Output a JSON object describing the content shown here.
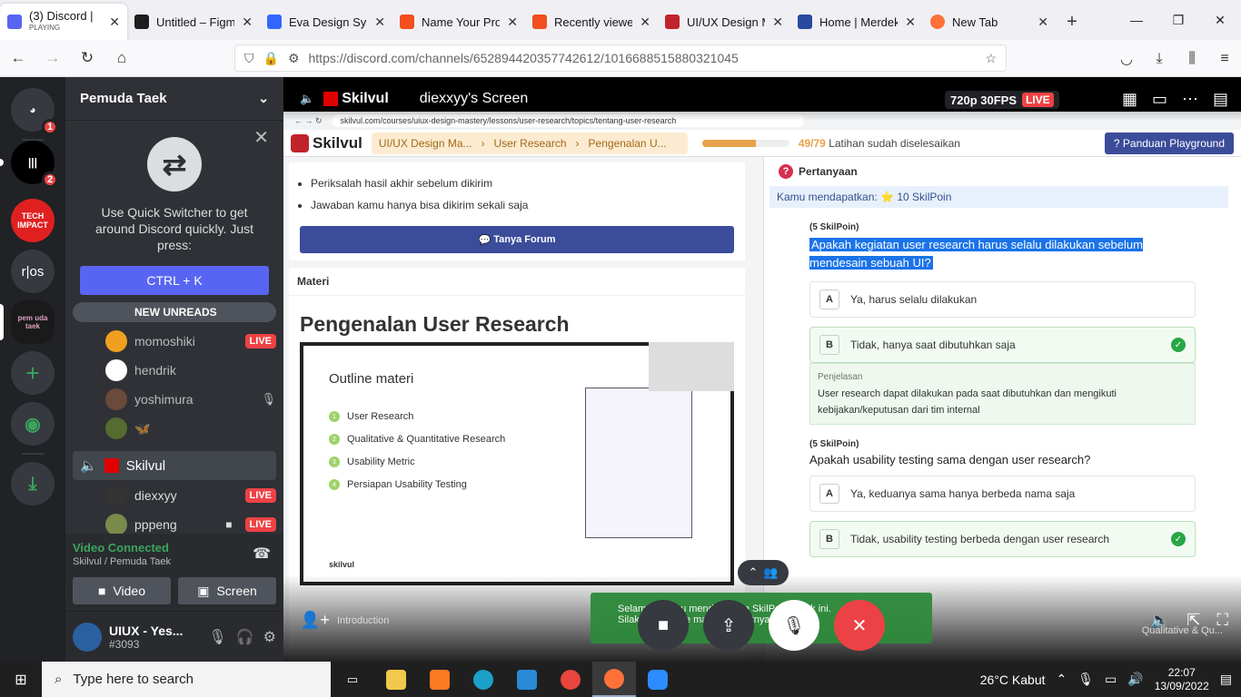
{
  "browser": {
    "tabs": [
      {
        "title": "(3) Discord | ",
        "sub": "PLAYING",
        "color": "#5865f2",
        "active": true
      },
      {
        "title": "Untitled – Figma",
        "color": "#1e1e1e"
      },
      {
        "title": "Eva Design Syste",
        "color": "#3366ff"
      },
      {
        "title": "Name Your Proje",
        "color": "#f24e1e"
      },
      {
        "title": "Recently viewed",
        "color": "#f24e1e"
      },
      {
        "title": "UI/UX Design Ma",
        "color": "#c0232c"
      },
      {
        "title": "Home | Merdeka",
        "color": "#2a4aa0"
      },
      {
        "title": "New Tab",
        "color": "#ff7139"
      }
    ],
    "url_domain": "https://discord.com",
    "url_path": "/channels/652894420357742612/1016688515880321045"
  },
  "discord": {
    "server_name": "Pemuda Taek",
    "guilds": [
      {
        "label": "",
        "badge": "1",
        "color": "#5865f2"
      },
      {
        "label": "",
        "badge": "2",
        "color": "#000"
      },
      {
        "label": "TECH IMPACT",
        "badge": "",
        "color": "#e02020"
      },
      {
        "label": "r|os",
        "badge": "",
        "color": "#36393f"
      },
      {
        "label": "pem uda taek",
        "badge": "",
        "color": "#1a1a1a"
      }
    ],
    "quick_switcher": {
      "text": "Use Quick Switcher to get around Discord quickly. Just press:",
      "shortcut": "CTRL + K"
    },
    "new_unreads": "NEW UNREADS",
    "voice_users_top": [
      {
        "name": "momoshiki",
        "live": "LIVE",
        "color": "#f0a020"
      },
      {
        "name": "hendrik",
        "live": "",
        "color": "#fff"
      },
      {
        "name": "yoshimura",
        "live": "",
        "color": "#6a4a3a"
      },
      {
        "name": "🦋",
        "live": "",
        "color": "#556b2f"
      }
    ],
    "voice_channel": "Skilvul",
    "voice_users": [
      {
        "name": "diexxyy",
        "live": "LIVE",
        "color": "#333"
      },
      {
        "name": "pppeng",
        "live": "LIVE",
        "color": "#7a8a4a"
      }
    ],
    "connection": {
      "status": "Video Connected",
      "location": "Skilvul / Pemuda Taek",
      "video": "Video",
      "screen": "Screen"
    },
    "me": {
      "name": "UIUX - Yes...",
      "tag": "#3093"
    }
  },
  "stream": {
    "channel": "Skilvul",
    "streamer": "diexxyy's Screen",
    "quality": "720p 30FPS",
    "live": "LIVE",
    "toast": "Selamat! Kamu mendapatkan SkilPoin untuk ini.",
    "toast2": "Silakan lanjut ke materi berikutnya",
    "bottom_left": "Introduction",
    "bottom_right": "Qualitative & Qu..."
  },
  "skilvul": {
    "url": "skilvul.com/courses/uiux-design-mastery/lessons/user-research/topics/tentang-user-research",
    "logo": "Skilvul",
    "crumbs": [
      "UI/UX Design Ma...",
      "User Research",
      "Pengenalan U..."
    ],
    "progress_pct": 0.62,
    "progress_text": "49/79",
    "progress_label": "Latihan sudah diselesaikan",
    "panduan": "Panduan Playground",
    "bullets": [
      "Periksalah hasil akhir sebelum dikirim",
      "Jawaban kamu hanya bisa dikirim sekali saja"
    ],
    "forum": "Tanya Forum",
    "materi": "Materi",
    "title": "Pengenalan User Research",
    "slide_title": "Outline materi",
    "slide_items": [
      "User Research",
      "Qualitative & Quantitative Research",
      "Usability Metric",
      "Persiapan Usability Testing"
    ],
    "slide_brand": "skilvul",
    "q_header": "Pertanyaan",
    "earned": "Kamu mendapatkan: ⭐ 10 SkilPoin",
    "q1": {
      "points": "(5 SkilPoin)",
      "text": "Apakah kegiatan user research harus selalu dilakukan sebelum mendesain sebuah UI?",
      "a": "Ya, harus selalu dilakukan",
      "b": "Tidak, hanya saat dibutuhkan saja",
      "expl_h": "Penjelasan",
      "expl": "User research dapat dilakukan pada saat dibutuhkan dan mengikuti kebijakan/keputusan dari tim internal"
    },
    "q2": {
      "points": "(5 SkilPoin)",
      "text": "Apakah usability testing sama dengan user research?",
      "a": "Ya, keduanya sama hanya berbeda nama saja",
      "b": "Tidak, usability testing berbeda dengan user research"
    }
  },
  "taskbar": {
    "search": "Type here to search",
    "weather": "26°C  Kabut",
    "time": "22:07",
    "date": "13/09/2022"
  }
}
